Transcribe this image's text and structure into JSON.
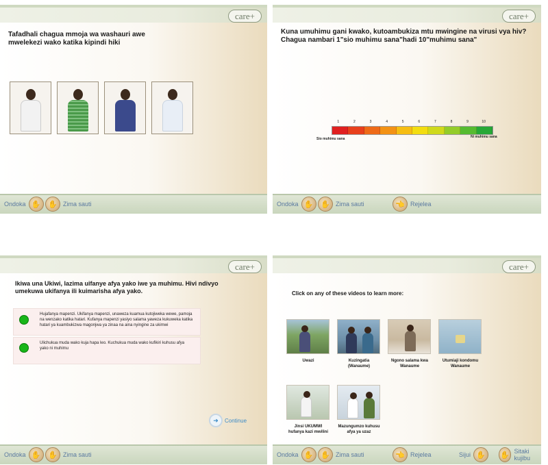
{
  "brand": {
    "logo": "care+"
  },
  "panel1": {
    "title": "Tafadhali chagua mmoja wa washauri awe mwelekezi wako katika kipindi hiki",
    "advisors": [
      {
        "shirt": "#f2f2f2",
        "pants": "#2a2a3a"
      },
      {
        "shirt": "#4a9a4a",
        "pants": "#333"
      },
      {
        "shirt": "#3b4a8c",
        "pants": "#3b4a8c"
      },
      {
        "shirt": "#e8eef6",
        "pants": "#3a3a3a"
      }
    ],
    "footer": {
      "leave": "Ondoka",
      "mute": "Zima sauti"
    }
  },
  "panel2": {
    "question": "Kuna umuhimu gani kwako, kutoambukiza mtu mwingine na virusi vya hiv? Chagua nambari 1\"sio muhimu sana\"hadi  10\"muhimu sana\"",
    "scale_numbers": [
      "1",
      "2",
      "3",
      "4",
      "5",
      "6",
      "7",
      "8",
      "9",
      "10"
    ],
    "scale_colors": [
      "#e02020",
      "#e8401c",
      "#ee6a18",
      "#f39214",
      "#f6bd12",
      "#f3dd10",
      "#cfd91c",
      "#94cc2a",
      "#56bb30",
      "#27a836"
    ],
    "label_low": "Sio muhimu sana",
    "label_high": "Ni muhimu sana",
    "footer": {
      "leave": "Ondoka",
      "mute": "Zima sauti",
      "back": "Rejelea"
    }
  },
  "panel3": {
    "heading": "Ikiwa una Ukiwi, lazima uifanye afya yako iwe ya muhimu. Hivi ndivyo umekuwa ukifanya ili kuimarisha afya yako.",
    "options": [
      {
        "text": "Hujafanya mapenzi. Ukifanya mapenzi, unaweza kuamua kutojiweka wewe, pamoja na wenzako katika hatari. Kufanya mapenzi yasiyo salama yaweza kukuweka katika hatari ya kuambukizwa magonjwa ya zinaa na aina nyingine za ukimwi"
      },
      {
        "text": "Ulichukua muda wako kuja hapa leo. Kuchukua muda wako kufikiri kuhusu afya yako ni muhimu"
      }
    ],
    "continue": "Continue",
    "footer": {
      "leave": "Ondoka",
      "mute": "Zima sauti"
    }
  },
  "panel4": {
    "heading": "Click on any of these videos to learn more:",
    "videos": [
      {
        "caption": "Uwazi",
        "bg": "#7ea563"
      },
      {
        "caption": "Kuzingatia (Wanaume)",
        "bg": "#7f9eb8"
      },
      {
        "caption": "Ngono salama kwa Wanaume",
        "bg": "#c9b9a0"
      },
      {
        "caption": "Utumiaji kondomu Wanaume",
        "bg": "#8fb2c8"
      },
      {
        "caption": "Jinsi UKUMWI hufanya kazi mwilini",
        "bg": "#b9c7b0"
      },
      {
        "caption": "Mazungumzo kuhusu afya ya uzaz",
        "bg": "#c8d3dc"
      }
    ],
    "footer": {
      "leave": "Ondoka",
      "mute": "Zima sauti",
      "back": "Rejelea",
      "ask": "Sijui",
      "decline": "Sitaki kujibu"
    }
  }
}
